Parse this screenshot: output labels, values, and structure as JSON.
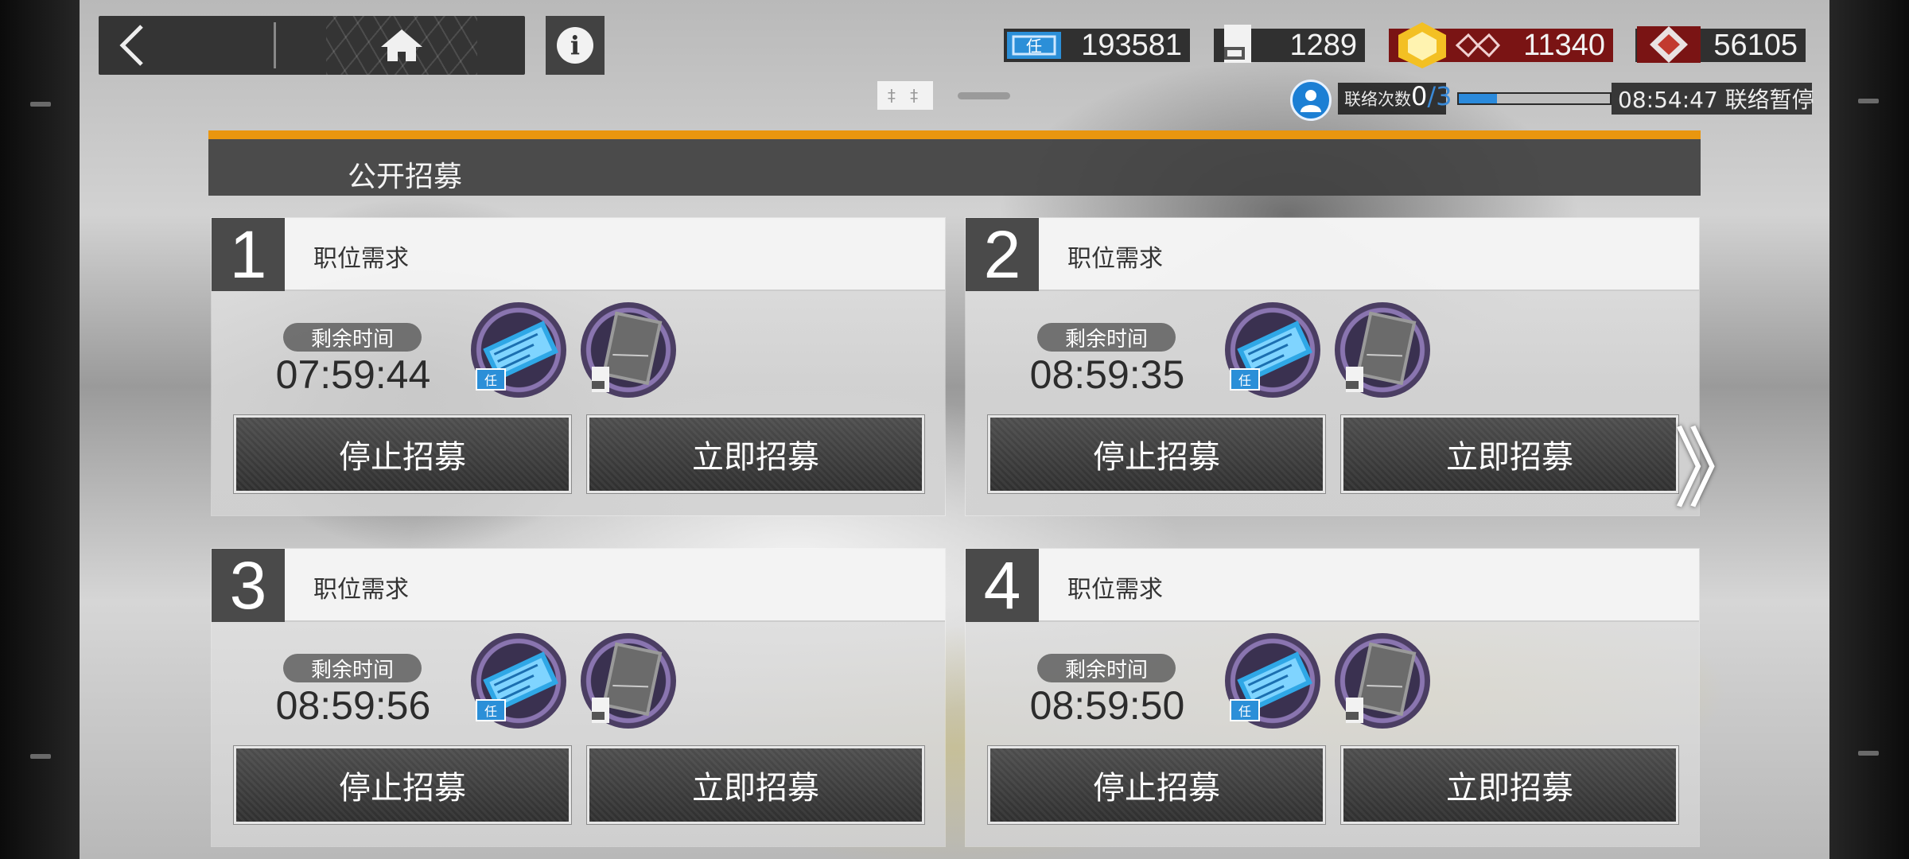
{
  "topbar": {
    "back_icon": "back-chevron-icon",
    "home_icon": "home-icon",
    "info_icon": "info-icon",
    "info_label": "i",
    "resources": [
      {
        "name": "recruitment-permit",
        "value": "193581",
        "color": "#2b8fd8"
      },
      {
        "name": "expedited-plan",
        "value": "1289",
        "color": "#f2f2f2"
      },
      {
        "name": "lmd",
        "value": "11340",
        "color": "#f3c023"
      },
      {
        "name": "originium",
        "value": "56105",
        "color": "#c23a2f"
      }
    ],
    "page_indicator": "‡ ‡"
  },
  "contact": {
    "label": "联络次数",
    "current": "0",
    "max": "/3",
    "progress": 0.25,
    "status": "08:54:47 联络暂停"
  },
  "header": {
    "title": "公开招募",
    "accent_color": "#e9960f"
  },
  "slots": [
    {
      "number": "1",
      "label": "职位需求",
      "time_label": "剩余时间",
      "time": "07:59:44",
      "stop_label": "停止招募",
      "now_label": "立即招募"
    },
    {
      "number": "2",
      "label": "职位需求",
      "time_label": "剩余时间",
      "time": "08:59:35",
      "stop_label": "停止招募",
      "now_label": "立即招募"
    },
    {
      "number": "3",
      "label": "职位需求",
      "time_label": "剩余时间",
      "time": "08:59:56",
      "stop_label": "停止招募",
      "now_label": "立即招募"
    },
    {
      "number": "4",
      "label": "职位需求",
      "time_label": "剩余时间",
      "time": "08:59:50",
      "stop_label": "停止招募",
      "now_label": "立即招募"
    }
  ],
  "next_icon": "double-chevron-right-icon",
  "next_label": "》"
}
